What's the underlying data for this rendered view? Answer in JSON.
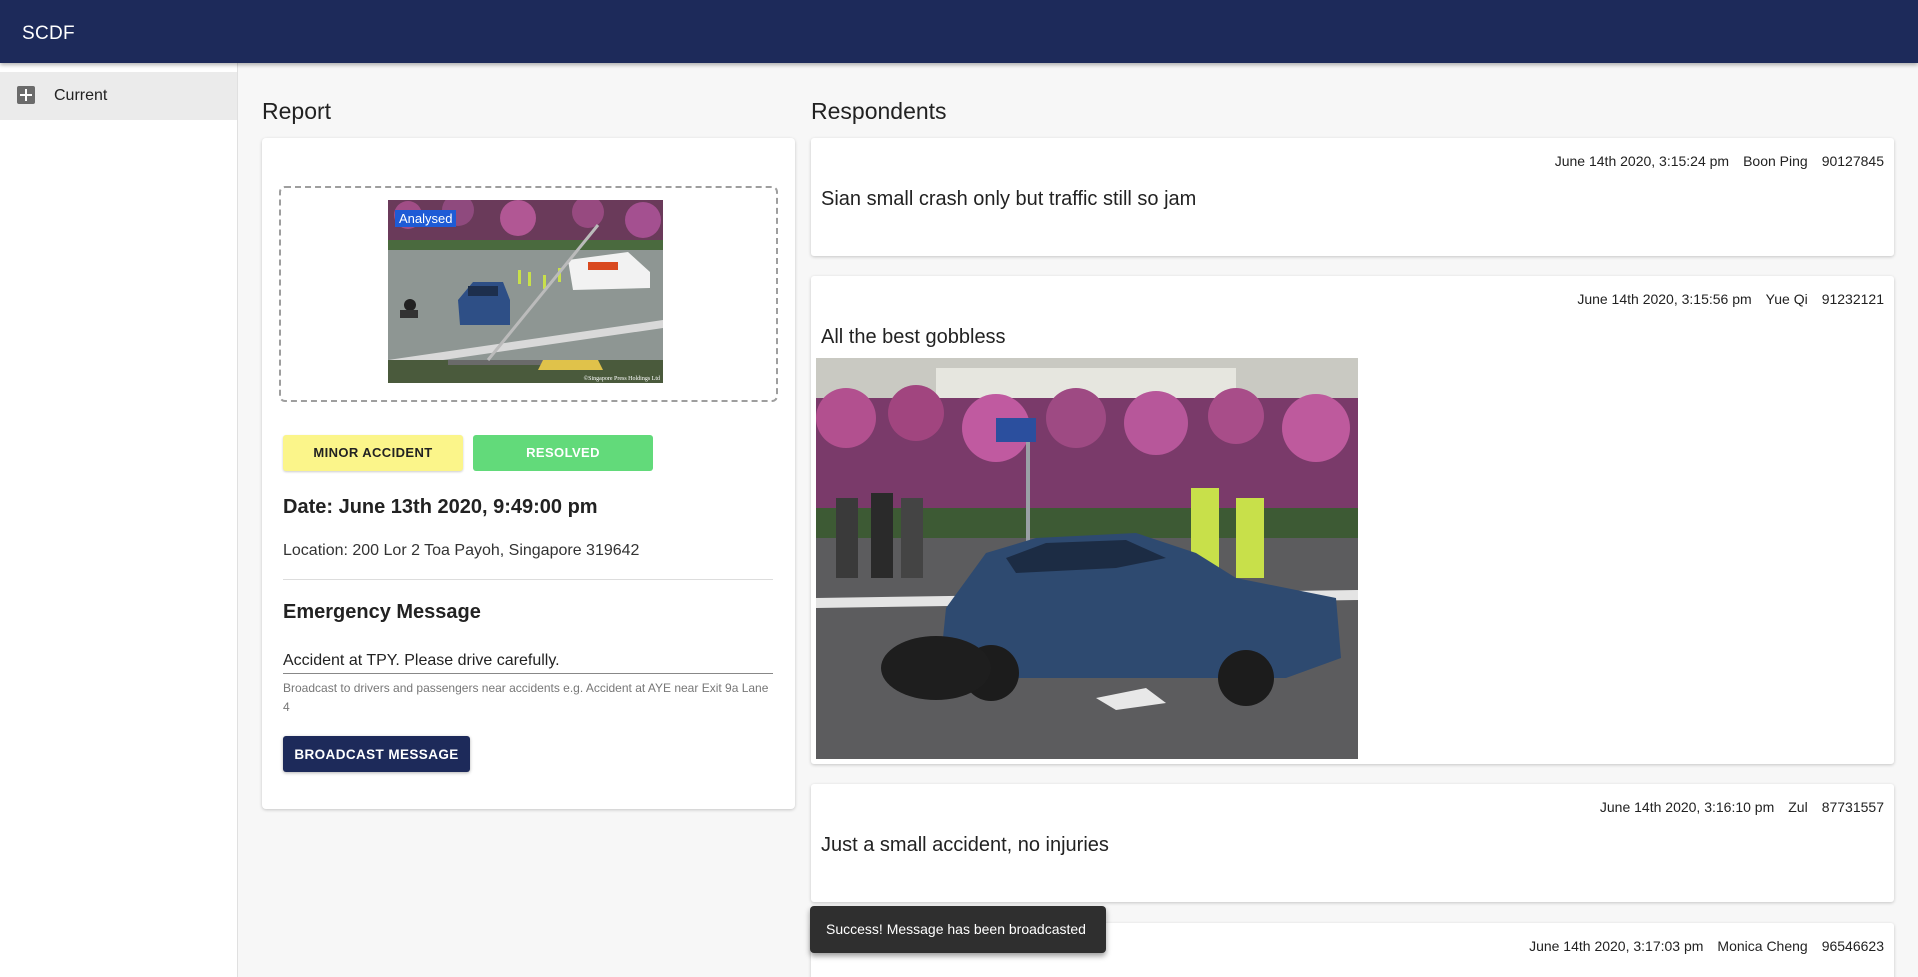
{
  "app": {
    "title": "SCDF"
  },
  "sidebar": {
    "items": [
      {
        "label": "Current",
        "icon": "plus-box-icon"
      }
    ]
  },
  "report": {
    "heading": "Report",
    "image_badge": "Analysed",
    "image_credit": "©Singapore Press Holdings Ltd",
    "severity_chip": "MINOR ACCIDENT",
    "status_chip": "RESOLVED",
    "date": "Date: June 13th 2020, 9:49:00 pm",
    "location": "Location: 200 Lor 2 Toa Payoh, Singapore 319642",
    "emergency_title": "Emergency Message",
    "emergency_value": "Accident at TPY. Please drive carefully.",
    "emergency_helper": "Broadcast to drivers and passengers near accidents e.g. Accident at AYE near Exit 9a Lane 4",
    "broadcast_button": "BROADCAST MESSAGE"
  },
  "respondents": {
    "heading": "Respondents",
    "items": [
      {
        "time": "June 14th 2020, 3:15:24 pm",
        "name": "Boon Ping",
        "phone": "90127845",
        "message": "Sian small crash only but traffic still so jam"
      },
      {
        "time": "June 14th 2020, 3:15:56 pm",
        "name": "Yue Qi",
        "phone": "91232121",
        "message": "All the best gobbless"
      },
      {
        "time": "June 14th 2020, 3:16:10 pm",
        "name": "Zul",
        "phone": "87731557",
        "message": "Just a small accident, no injuries"
      },
      {
        "time": "June 14th 2020, 3:17:03 pm",
        "name": "Monica Cheng",
        "phone": "96546623",
        "message": ""
      }
    ]
  },
  "snackbar": {
    "message": "Success! Message has been broadcasted"
  },
  "colors": {
    "appbar": "#1d2a5a",
    "minor_chip": "#fbf58a",
    "resolved_chip": "#62da7a",
    "analysed_badge": "#1e5bd6"
  }
}
